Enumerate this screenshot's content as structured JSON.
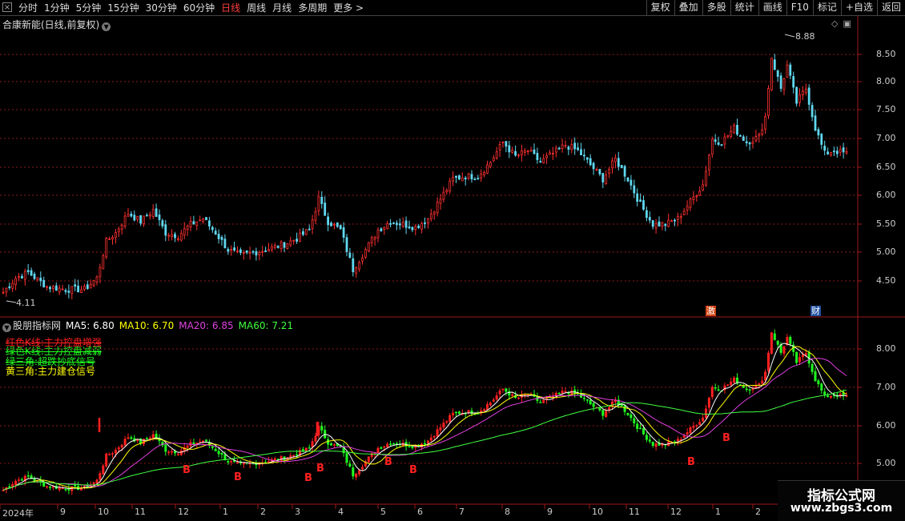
{
  "toolbar": {
    "close_glyph": "×",
    "periods": [
      "分时",
      "1分钟",
      "5分钟",
      "15分钟",
      "30分钟",
      "60分钟",
      "日线",
      "周线",
      "月线",
      "多周期",
      "更多 >"
    ],
    "active_period": "日线",
    "right_buttons": [
      "复权",
      "叠加",
      "多股",
      "统计",
      "画线",
      "F10",
      "标记",
      "+自选",
      "返回"
    ]
  },
  "main": {
    "title": "合康新能(日线,前复权)",
    "high_label": "8.88",
    "low_label": "4.11",
    "y_ticks": [
      "8.50",
      "8.00",
      "7.50",
      "7.00",
      "6.50",
      "6.00",
      "5.50",
      "5.00",
      "4.50"
    ],
    "badges": [
      "激",
      "财"
    ]
  },
  "indicator": {
    "name": "股朋指标网",
    "ma": [
      {
        "label": "MA5: 6.80",
        "color": "#ffffff"
      },
      {
        "label": "MA10: 6.70",
        "color": "#ffff00"
      },
      {
        "label": "MA20: 6.85",
        "color": "#e040e0"
      },
      {
        "label": "MA60: 7.21",
        "color": "#40ff40"
      }
    ],
    "legend": [
      {
        "text": "红色K线:主力控盘增强",
        "color": "#ff2020"
      },
      {
        "text": "绿色K线:主力控盘减弱",
        "color": "#20ff20"
      },
      {
        "text": "绿三角:超跌抄底信号",
        "color": "#20ff20"
      },
      {
        "text": "黄三角:主力建仓信号",
        "color": "#ffff00"
      }
    ],
    "y_ticks": [
      "8.00",
      "7.00",
      "6.00",
      "5.00"
    ],
    "signal_marks": [
      "B",
      "B",
      "B",
      "B",
      "B",
      "B",
      "B",
      "B"
    ]
  },
  "x_axis": {
    "labels": [
      "2024年",
      "9",
      "10",
      "11",
      "12",
      "1",
      "2",
      "3",
      "4",
      "5",
      "6",
      "7",
      "8",
      "9",
      "10",
      "11",
      "12",
      "1",
      "2"
    ]
  },
  "watermark": {
    "line1": "指标公式网",
    "line2": "www.zbgs3.com"
  },
  "chart_data": {
    "type": "candlestick",
    "y_range_main": [
      4.11,
      8.88
    ],
    "y_range_indicator": [
      4.6,
      8.5
    ],
    "moving_averages": [
      "MA5",
      "MA10",
      "MA20",
      "MA60"
    ],
    "close_anchors": [
      [
        0,
        4.3
      ],
      [
        4,
        4.55
      ],
      [
        8,
        4.65
      ],
      [
        14,
        4.4
      ],
      [
        20,
        4.35
      ],
      [
        26,
        4.35
      ],
      [
        30,
        4.55
      ],
      [
        33,
        5.2
      ],
      [
        36,
        5.35
      ],
      [
        40,
        5.7
      ],
      [
        44,
        5.55
      ],
      [
        48,
        5.75
      ],
      [
        52,
        5.35
      ],
      [
        56,
        5.3
      ],
      [
        60,
        5.5
      ],
      [
        64,
        5.6
      ],
      [
        68,
        5.35
      ],
      [
        72,
        5.05
      ],
      [
        76,
        4.95
      ],
      [
        80,
        5.0
      ],
      [
        84,
        5.05
      ],
      [
        90,
        5.15
      ],
      [
        94,
        5.25
      ],
      [
        98,
        5.4
      ],
      [
        101,
        5.95
      ],
      [
        104,
        5.55
      ],
      [
        108,
        5.4
      ],
      [
        112,
        4.7
      ],
      [
        116,
        5.05
      ],
      [
        120,
        5.4
      ],
      [
        124,
        5.55
      ],
      [
        128,
        5.5
      ],
      [
        132,
        5.45
      ],
      [
        136,
        5.6
      ],
      [
        140,
        5.95
      ],
      [
        144,
        6.3
      ],
      [
        148,
        6.35
      ],
      [
        152,
        6.35
      ],
      [
        156,
        6.6
      ],
      [
        160,
        6.95
      ],
      [
        164,
        6.7
      ],
      [
        168,
        6.8
      ],
      [
        172,
        6.6
      ],
      [
        176,
        6.75
      ],
      [
        180,
        6.9
      ],
      [
        184,
        6.8
      ],
      [
        188,
        6.55
      ],
      [
        192,
        6.3
      ],
      [
        196,
        6.65
      ],
      [
        200,
        6.3
      ],
      [
        204,
        5.85
      ],
      [
        208,
        5.5
      ],
      [
        212,
        5.5
      ],
      [
        216,
        5.6
      ],
      [
        220,
        5.9
      ],
      [
        224,
        6.2
      ],
      [
        227,
        7.0
      ],
      [
        230,
        6.95
      ],
      [
        234,
        7.2
      ],
      [
        238,
        6.95
      ],
      [
        242,
        7.05
      ],
      [
        244,
        7.4
      ],
      [
        246,
        8.45
      ],
      [
        249,
        7.9
      ],
      [
        251,
        8.3
      ],
      [
        254,
        7.65
      ],
      [
        257,
        7.9
      ],
      [
        260,
        7.2
      ],
      [
        263,
        6.75
      ],
      [
        266,
        6.8
      ],
      [
        270,
        6.75
      ]
    ]
  }
}
